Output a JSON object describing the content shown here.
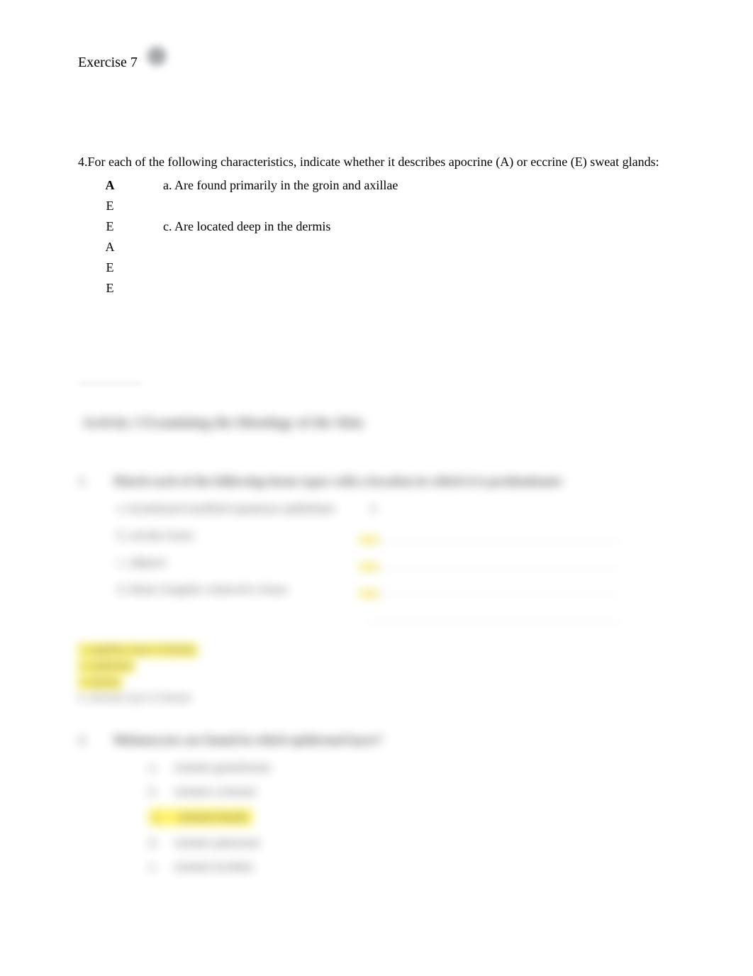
{
  "header": {
    "title": "Exercise 7"
  },
  "question4": {
    "prompt": "4.For each of the following characteristics, indicate whether it describes apocrine (A) or eccrine (E) sweat glands:",
    "rows": [
      {
        "answer": "A",
        "bold": true,
        "desc": "a. Are found primarily in the groin and axillae"
      },
      {
        "answer": "E",
        "bold": false,
        "desc": ""
      },
      {
        "answer": "E",
        "bold": false,
        "desc": "c. Are located deep in the dermis"
      },
      {
        "answer": "A",
        "bold": false,
        "desc": ""
      },
      {
        "answer": "E",
        "bold": false,
        "desc": ""
      },
      {
        "answer": "E",
        "bold": false,
        "desc": ""
      }
    ]
  },
  "blurred": {
    "activity_heading": "Activity 3 Examining the Histology of the Skin",
    "q1": {
      "num": "1.",
      "text": "Match each of the following tissue types with a location in which it is predominant:",
      "options": [
        "a. keratinized stratified squamous epithelium",
        "b. areolar tissue",
        "c. adipose",
        "d. dense irregular connective tissue"
      ],
      "right_marks": [
        "1.",
        "2.",
        "3.",
        "4."
      ]
    },
    "notes": [
      "1. papillary layer of dermis",
      "2. epidermis",
      "3. dermis",
      "4. reticular layer of dermis"
    ],
    "q2": {
      "num": "2.",
      "text": "Melanocytes are found in which epidermal layer?",
      "choices": [
        {
          "letter": "a.",
          "text": "stratum granulosum",
          "hl": false
        },
        {
          "letter": "b.",
          "text": "stratum corneum",
          "hl": false
        },
        {
          "letter": "c.",
          "text": "stratum basale",
          "hl": true
        },
        {
          "letter": "d.",
          "text": "stratum spinosum",
          "hl": false
        },
        {
          "letter": "e.",
          "text": "stratum lucidum",
          "hl": false
        }
      ]
    }
  }
}
